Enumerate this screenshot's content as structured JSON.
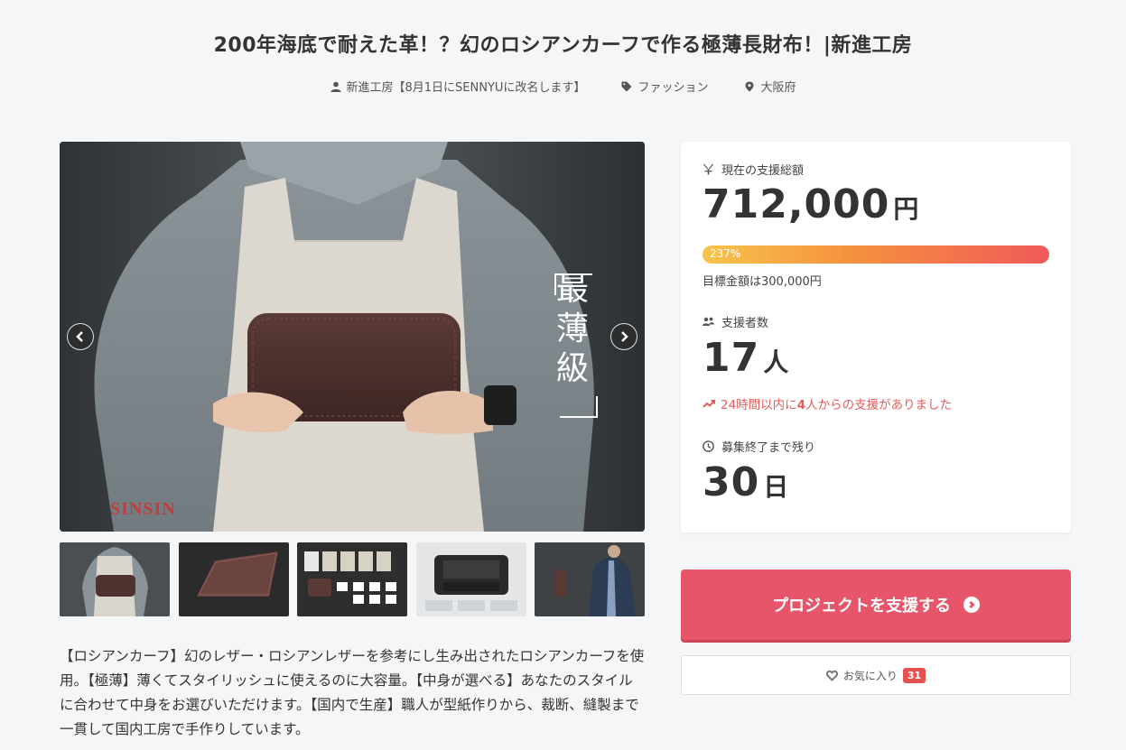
{
  "project": {
    "title": "200年海底で耐えた革！？幻のロシアンカーフで作る極薄長財布！|新進工房",
    "owner": "新進工房【8月1日にSENNYUに改名します】",
    "category": "ファッション",
    "location": "大阪府"
  },
  "gallery": {
    "overlay_text": "最薄級",
    "watermark": "SINSIN",
    "thumbnails": [
      "thumb-1",
      "thumb-2",
      "thumb-3",
      "thumb-4",
      "thumb-5"
    ]
  },
  "description": "【ロシアンカーフ】幻のレザー・ロシアンレザーを参考にし生み出されたロシアンカーフを使用。【極薄】薄くてスタイリッシュに使えるのに大容量。【中身が選べる】あなたのスタイルに合わせて中身をお選びいただけます。【国内で生産】職人が型紙作りから、裁断、縫製まで一貫して国内工房で手作りしています。",
  "stats": {
    "total_label": "現在の支援総額",
    "total_amount": "712,000",
    "total_unit": "円",
    "progress_label": "237%",
    "progress_percent": 237,
    "goal_text": "目標金額は300,000円",
    "backers_label": "支援者数",
    "backers_count": "17",
    "backers_unit": "人",
    "recent_prefix": "24時間以内に",
    "recent_count": "4",
    "recent_suffix": "人からの支援がありました",
    "remaining_label": "募集終了まで残り",
    "remaining_days": "30",
    "remaining_unit": "日"
  },
  "actions": {
    "support_label": "プロジェクトを支援する",
    "favorite_label": "お気に入り",
    "favorite_count": "31"
  },
  "colors": {
    "accent": "#e6556a",
    "trend": "#e65d5d",
    "badge": "#e55050"
  },
  "icons": {
    "owner": "user-icon",
    "category": "tag-icon",
    "location": "location-pin-icon",
    "total": "yen-icon",
    "backers": "users-icon",
    "remaining": "clock-icon",
    "trend": "trend-up-icon",
    "favorite": "heart-icon"
  }
}
